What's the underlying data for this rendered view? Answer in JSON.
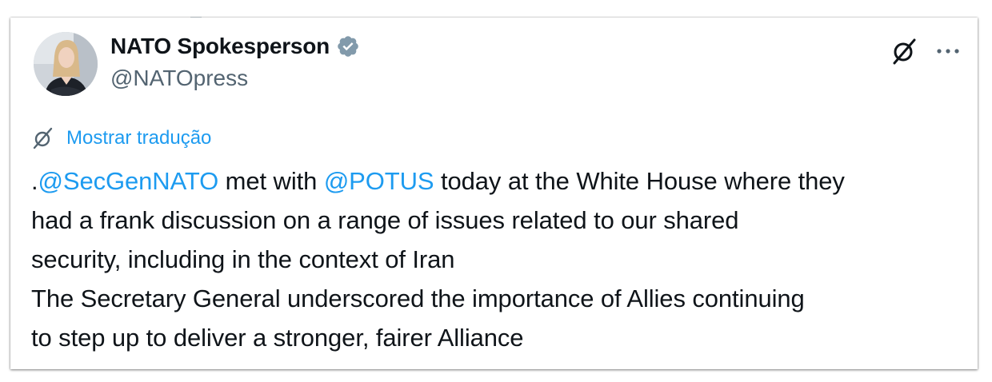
{
  "author": {
    "display_name": "NATO Spokesperson",
    "handle": "@NATOpress",
    "verified_icon": "verified-badge-icon",
    "verified_color": "#829aab"
  },
  "actions": {
    "grok_icon": "grok-icon",
    "more_icon": "more-options-icon",
    "more_glyph": "···"
  },
  "translation": {
    "icon": "grok-icon",
    "label": "Mostrar tradução"
  },
  "tweet": {
    "line1_prefix": ".",
    "mention1": "@SecGenNATO",
    "line1_mid": " met with ",
    "mention2": "@POTUS",
    "line1_suffix": " today at the White House where they",
    "line2": "had a frank discussion on a range of issues related to our shared",
    "line3": "security, including in the context of Iran",
    "line4": "The Secretary General underscored the importance of Allies continuing",
    "line5": "to step up to deliver a stronger, fairer Alliance"
  },
  "colors": {
    "text": "#0f1419",
    "secondary": "#536471",
    "link": "#1d9bf0"
  }
}
